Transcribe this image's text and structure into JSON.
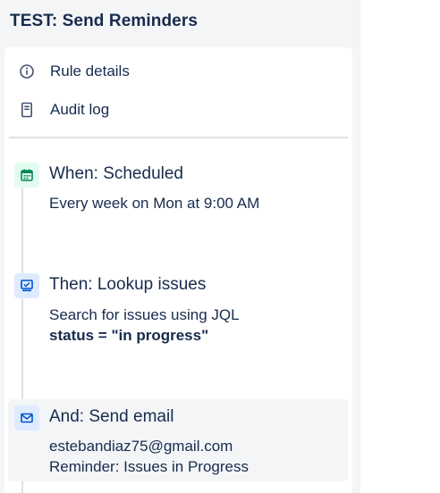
{
  "rule_title": "TEST: Send Reminders",
  "nav": [
    {
      "label": "Rule details",
      "icon": "info-icon"
    },
    {
      "label": "Audit log",
      "icon": "document-icon"
    }
  ],
  "steps": [
    {
      "title": "When: Scheduled",
      "icon": "calendar-icon",
      "icon_color": "#00875a",
      "icon_bg": "#e3fcef",
      "lines": [
        "Every week on Mon at 9:00 AM"
      ]
    },
    {
      "title": "Then: Lookup issues",
      "icon": "lookup-screen-icon",
      "icon_color": "#0052cc",
      "icon_bg": "#deebff",
      "lines": [
        "Search for issues using JQL",
        "status = \"in progress\""
      ]
    },
    {
      "title": "And: Send email",
      "icon": "envelope-icon",
      "icon_color": "#0052cc",
      "icon_bg": "#deebff",
      "lines": [
        "estebandiaz75@gmail.com",
        "Reminder: Issues in Progress"
      ]
    }
  ]
}
